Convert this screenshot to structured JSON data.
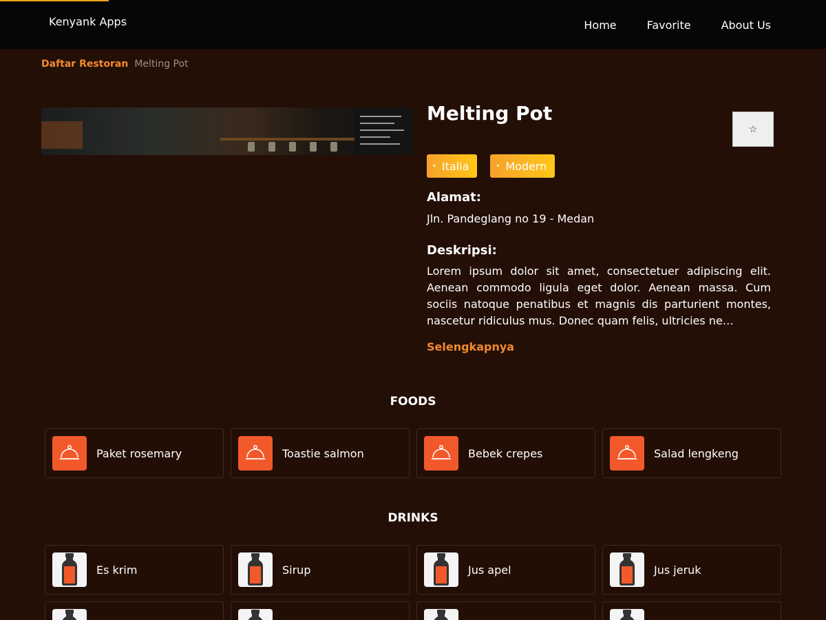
{
  "navbar": {
    "brand": "Kenyank Apps",
    "links": [
      "Home",
      "Favorite",
      "About Us"
    ]
  },
  "breadcrumb": {
    "parent": "Daftar Restoran",
    "current": "Melting Pot"
  },
  "restaurant": {
    "name": "Melting Pot",
    "favorite_icon": "star-outline-icon",
    "favorite_glyph": "☆",
    "tags": [
      "Italia",
      "Modern"
    ],
    "tag_dot": "•",
    "address_label": "Alamat:",
    "address": "Jln. Pandeglang no 19 - Medan",
    "description_label": "Deskripsi:",
    "description": "Lorem ipsum dolor sit amet, consectetuer adipiscing elit. Aenean commodo ligula eget dolor. Aenean massa. Cum sociis natoque penatibus et magnis dis parturient montes, nascetur ridiculus mus. Donec quam felis, ultricies ne…",
    "more_label": "Selengkapnya"
  },
  "foods": {
    "heading": "FOODS",
    "icon": "serving-dish-icon",
    "items": [
      "Paket rosemary",
      "Toastie salmon",
      "Bebek crepes",
      "Salad lengkeng"
    ]
  },
  "drinks": {
    "heading": "DRINKS",
    "icon": "juice-bottle-icon",
    "items": [
      "Es krim",
      "Sirup",
      "Jus apel",
      "Jus jeruk"
    ]
  },
  "colors": {
    "accent": "#f38a2e",
    "background": "#230f06",
    "navbar": "#060606",
    "food_icon_bg": "#f2592a",
    "tag_gradient_start": "#f7a12b",
    "tag_gradient_end": "#fec718"
  }
}
